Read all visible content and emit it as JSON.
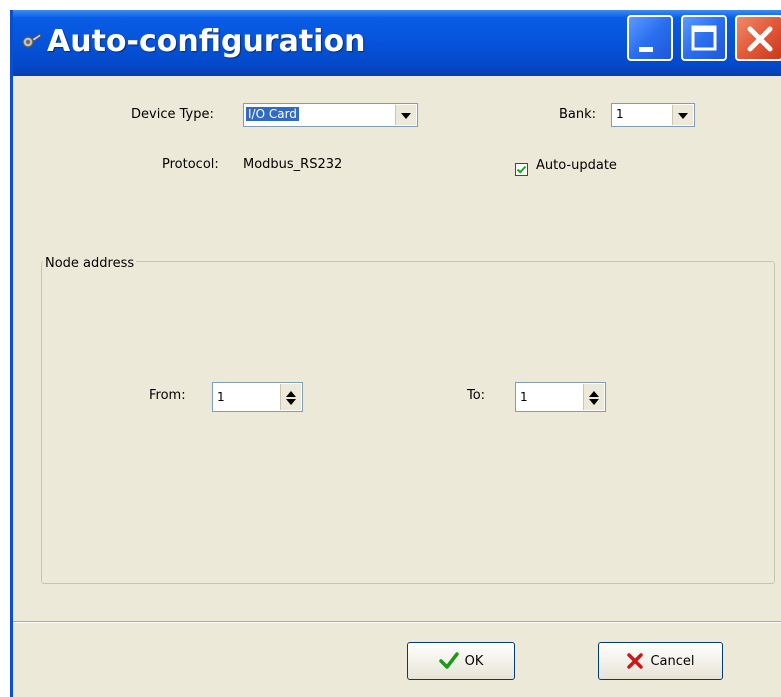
{
  "window": {
    "title": "Auto-configuration",
    "icons": {
      "app": "wrench-gear-icon",
      "minimize": "minimize-icon",
      "maximize": "maximize-icon",
      "close": "close-icon"
    },
    "colors": {
      "titlebar": "#0553da",
      "close": "#e35a3a",
      "dialog_bg": "#ece9d8",
      "selection": "#316ac5"
    }
  },
  "device_type": {
    "label": "Device Type:",
    "value": "I/O Card"
  },
  "bank": {
    "label": "Bank:",
    "value": "1"
  },
  "protocol": {
    "label": "Protocol:",
    "value": "Modbus_RS232"
  },
  "auto_update": {
    "label": "Auto-update",
    "checked": true
  },
  "node_address": {
    "title": "Node address",
    "from": {
      "label": "From:",
      "value": "1"
    },
    "to": {
      "label": "To:",
      "value": "1"
    }
  },
  "buttons": {
    "ok": {
      "label": "OK",
      "icon": "checkmark-icon"
    },
    "cancel": {
      "label": "Cancel",
      "icon": "x-icon"
    }
  }
}
